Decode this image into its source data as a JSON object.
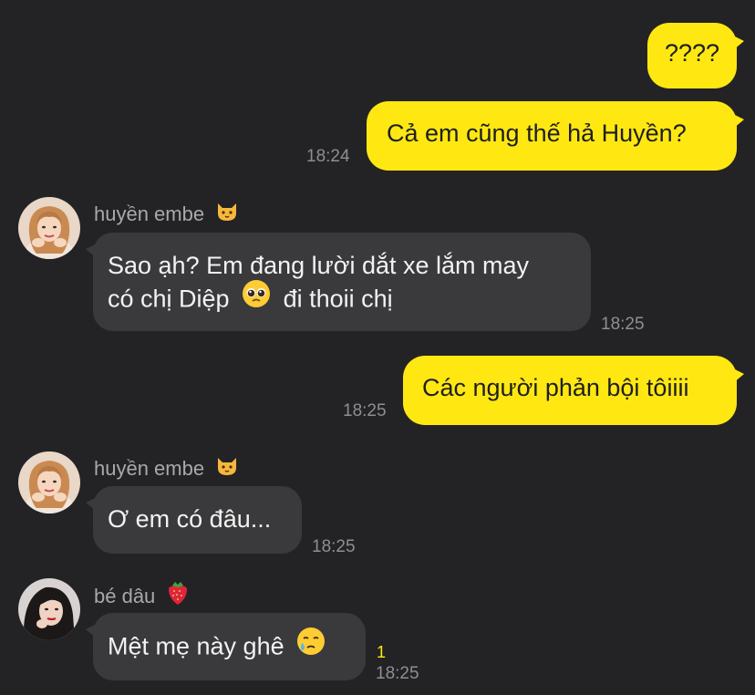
{
  "colors": {
    "background": "#232325",
    "outgoing_bubble": "#FFE812",
    "incoming_bubble": "#3A3A3C",
    "timestamp": "#8E8E93",
    "unread_count": "#FFE812"
  },
  "messages": [
    {
      "direction": "out",
      "text": "????"
    },
    {
      "direction": "out",
      "text": "Cả em cũng thế hả Huyền?",
      "time": "18:24"
    },
    {
      "direction": "in",
      "sender": "huyền embe",
      "sender_emoji": "cat-face-icon",
      "line1": "Sao ạh? Em đang lười dắt xe lắm may",
      "line2_a": "có chị Diệp",
      "emoji": "pleading-face-icon",
      "line2_b": "đi thoii chị",
      "time": "18:25"
    },
    {
      "direction": "out",
      "text": "Các người phản bội tôiiii",
      "time": "18:25"
    },
    {
      "direction": "in",
      "sender": "huyền embe",
      "sender_emoji": "cat-face-icon",
      "text": "Ơ em có đâu...",
      "time": "18:25"
    },
    {
      "direction": "in",
      "sender": "bé dâu",
      "sender_emoji": "strawberry-icon",
      "text": "Mệt mẹ này ghê",
      "emoji": "crying-face-icon",
      "unread": "1",
      "time": "18:25"
    }
  ]
}
